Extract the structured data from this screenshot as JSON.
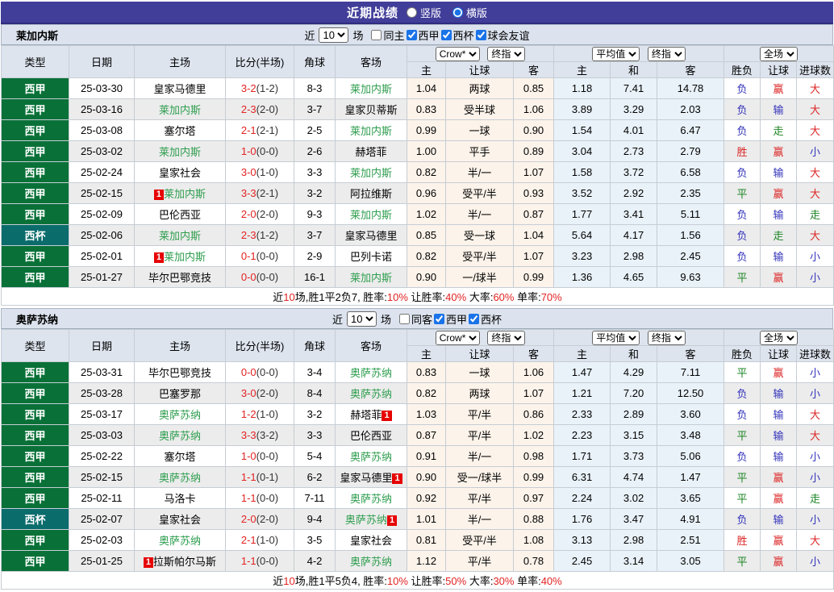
{
  "top_bar": {
    "title": "近期战绩",
    "view_options": [
      {
        "label": "竖版",
        "selected": false
      },
      {
        "label": "横版",
        "selected": true
      }
    ]
  },
  "colors": {
    "top_bar_bg": "#413e9a",
    "liga_green": "#097138",
    "cup_teal": "#0b6c6c",
    "team_green": "#2f9e4f",
    "score_red": "#e32222",
    "badge_red": "#e60000",
    "bar_bg": "#dce3ee",
    "header_bg": "#dde4ee",
    "row_alt_bg": "#ececec",
    "handicap_col_bg": "#fcf3ea",
    "europe_col_bg": "#e9f2f9",
    "result_red": "#dd2626",
    "result_blue": "#3333bb",
    "result_green": "#1d8525"
  },
  "result_colors": {
    "胜": "#dd2626",
    "平": "#1d8525",
    "负": "#3333bb",
    "赢": "#dd2626",
    "走": "#1d8525",
    "输": "#3333bb",
    "大": "#dd2626",
    "小": "#3333bb"
  },
  "sections": [
    {
      "team": "莱加内斯",
      "filter": {
        "recent_label": "近",
        "count_value": "10",
        "matches_label": "场",
        "checkboxes": [
          {
            "label": "同主",
            "checked": false
          },
          {
            "label": "西甲",
            "checked": true
          },
          {
            "label": "西杯",
            "checked": true
          },
          {
            "label": "球会友谊",
            "checked": true
          }
        ]
      },
      "header": {
        "cols": [
          "类型",
          "日期",
          "主场",
          "比分(半场)",
          "角球",
          "客场"
        ],
        "group1_selects": [
          "Crow*",
          "终指"
        ],
        "group2_selects": [
          "平均值",
          "终指"
        ],
        "group3_selects": [
          "全场"
        ],
        "sub": [
          "主",
          "让球",
          "客",
          "主",
          "和",
          "客",
          "胜负",
          "让球",
          "进球数"
        ]
      },
      "rows": [
        {
          "league": {
            "text": "西甲",
            "type": "liga"
          },
          "date": "25-03-30",
          "home": {
            "name": "皇家马德里",
            "green": false,
            "badge": null
          },
          "score": {
            "ft": "3-2",
            "ht": "(1-2)"
          },
          "corner": "8-3",
          "away": {
            "name": "莱加内斯",
            "green": true,
            "badge": null
          },
          "ah": [
            "1.04",
            "两球",
            "0.85"
          ],
          "eu": [
            "1.18",
            "7.41",
            "14.78"
          ],
          "results": [
            "负",
            "赢",
            "大"
          ]
        },
        {
          "league": {
            "text": "西甲",
            "type": "liga"
          },
          "date": "25-03-16",
          "home": {
            "name": "莱加内斯",
            "green": true,
            "badge": null
          },
          "score": {
            "ft": "2-3",
            "ht": "(2-0)"
          },
          "corner": "3-7",
          "away": {
            "name": "皇家贝蒂斯",
            "green": false,
            "badge": null
          },
          "ah": [
            "0.83",
            "受半球",
            "1.06"
          ],
          "eu": [
            "3.89",
            "3.29",
            "2.03"
          ],
          "results": [
            "负",
            "输",
            "大"
          ]
        },
        {
          "league": {
            "text": "西甲",
            "type": "liga"
          },
          "date": "25-03-08",
          "home": {
            "name": "塞尔塔",
            "green": false,
            "badge": null
          },
          "score": {
            "ft": "2-1",
            "ht": "(2-1)"
          },
          "corner": "2-5",
          "away": {
            "name": "莱加内斯",
            "green": true,
            "badge": null
          },
          "ah": [
            "0.99",
            "一球",
            "0.90"
          ],
          "eu": [
            "1.54",
            "4.01",
            "6.47"
          ],
          "results": [
            "负",
            "走",
            "大"
          ]
        },
        {
          "league": {
            "text": "西甲",
            "type": "liga"
          },
          "date": "25-03-02",
          "home": {
            "name": "莱加内斯",
            "green": true,
            "badge": null
          },
          "score": {
            "ft": "1-0",
            "ht": "(0-0)"
          },
          "corner": "2-6",
          "away": {
            "name": "赫塔菲",
            "green": false,
            "badge": null
          },
          "ah": [
            "1.00",
            "平手",
            "0.89"
          ],
          "eu": [
            "3.04",
            "2.73",
            "2.79"
          ],
          "results": [
            "胜",
            "赢",
            "小"
          ]
        },
        {
          "league": {
            "text": "西甲",
            "type": "liga"
          },
          "date": "25-02-24",
          "home": {
            "name": "皇家社会",
            "green": false,
            "badge": null
          },
          "score": {
            "ft": "3-0",
            "ht": "(1-0)"
          },
          "corner": "3-3",
          "away": {
            "name": "莱加内斯",
            "green": true,
            "badge": null
          },
          "ah": [
            "0.82",
            "半/一",
            "1.07"
          ],
          "eu": [
            "1.58",
            "3.72",
            "6.58"
          ],
          "results": [
            "负",
            "输",
            "大"
          ]
        },
        {
          "league": {
            "text": "西甲",
            "type": "liga"
          },
          "date": "25-02-15",
          "home": {
            "name": "莱加内斯",
            "green": true,
            "badge": {
              "text": "1",
              "pos": "before"
            }
          },
          "score": {
            "ft": "3-3",
            "ht": "(2-1)"
          },
          "corner": "3-2",
          "away": {
            "name": "阿拉维斯",
            "green": false,
            "badge": null
          },
          "ah": [
            "0.96",
            "受平/半",
            "0.93"
          ],
          "eu": [
            "3.52",
            "2.92",
            "2.35"
          ],
          "results": [
            "平",
            "赢",
            "大"
          ]
        },
        {
          "league": {
            "text": "西甲",
            "type": "liga"
          },
          "date": "25-02-09",
          "home": {
            "name": "巴伦西亚",
            "green": false,
            "badge": null
          },
          "score": {
            "ft": "2-0",
            "ht": "(2-0)"
          },
          "corner": "9-3",
          "away": {
            "name": "莱加内斯",
            "green": true,
            "badge": null
          },
          "ah": [
            "1.02",
            "半/一",
            "0.87"
          ],
          "eu": [
            "1.77",
            "3.41",
            "5.11"
          ],
          "results": [
            "负",
            "输",
            "走"
          ]
        },
        {
          "league": {
            "text": "西杯",
            "type": "cup"
          },
          "date": "25-02-06",
          "home": {
            "name": "莱加内斯",
            "green": true,
            "badge": null
          },
          "score": {
            "ft": "2-3",
            "ht": "(1-2)"
          },
          "corner": "3-7",
          "away": {
            "name": "皇家马德里",
            "green": false,
            "badge": null
          },
          "ah": [
            "0.85",
            "受一球",
            "1.04"
          ],
          "eu": [
            "5.64",
            "4.17",
            "1.56"
          ],
          "results": [
            "负",
            "走",
            "大"
          ]
        },
        {
          "league": {
            "text": "西甲",
            "type": "liga"
          },
          "date": "25-02-01",
          "home": {
            "name": "莱加内斯",
            "green": true,
            "badge": {
              "text": "1",
              "pos": "before"
            }
          },
          "score": {
            "ft": "0-1",
            "ht": "(0-0)"
          },
          "corner": "2-9",
          "away": {
            "name": "巴列卡诺",
            "green": false,
            "badge": null
          },
          "ah": [
            "0.82",
            "受平/半",
            "1.07"
          ],
          "eu": [
            "3.23",
            "2.98",
            "2.45"
          ],
          "results": [
            "负",
            "输",
            "小"
          ]
        },
        {
          "league": {
            "text": "西甲",
            "type": "liga"
          },
          "date": "25-01-27",
          "home": {
            "name": "毕尔巴鄂竞技",
            "green": false,
            "badge": null
          },
          "score": {
            "ft": "0-0",
            "ht": "(0-0)"
          },
          "corner": "16-1",
          "away": {
            "name": "莱加内斯",
            "green": true,
            "badge": null
          },
          "ah": [
            "0.90",
            "一/球半",
            "0.99"
          ],
          "eu": [
            "1.36",
            "4.65",
            "9.63"
          ],
          "results": [
            "平",
            "赢",
            "小"
          ]
        }
      ],
      "footer": {
        "segments": [
          {
            "text": "近"
          },
          {
            "text": "10",
            "red": true
          },
          {
            "text": "场,胜1平2负7, 胜率:"
          },
          {
            "text": "10%",
            "red": true
          },
          {
            "text": " 让胜率:"
          },
          {
            "text": "40%",
            "red": true
          },
          {
            "text": " 大率:"
          },
          {
            "text": "60%",
            "red": true
          },
          {
            "text": " 单率:"
          },
          {
            "text": "70%",
            "red": true
          }
        ]
      }
    },
    {
      "team": "奥萨苏纳",
      "filter": {
        "recent_label": "近",
        "count_value": "10",
        "matches_label": "场",
        "checkboxes": [
          {
            "label": "同客",
            "checked": false
          },
          {
            "label": "西甲",
            "checked": true
          },
          {
            "label": "西杯",
            "checked": true
          }
        ]
      },
      "header": {
        "cols": [
          "类型",
          "日期",
          "主场",
          "比分(半场)",
          "角球",
          "客场"
        ],
        "group1_selects": [
          "Crow*",
          "终指"
        ],
        "group2_selects": [
          "平均值",
          "终指"
        ],
        "group3_selects": [
          "全场"
        ],
        "sub": [
          "主",
          "让球",
          "客",
          "主",
          "和",
          "客",
          "胜负",
          "让球",
          "进球数"
        ]
      },
      "rows": [
        {
          "league": {
            "text": "西甲",
            "type": "liga"
          },
          "date": "25-03-31",
          "home": {
            "name": "毕尔巴鄂竞技",
            "green": false,
            "badge": null
          },
          "score": {
            "ft": "0-0",
            "ht": "(0-0)"
          },
          "corner": "3-4",
          "away": {
            "name": "奥萨苏纳",
            "green": true,
            "badge": null
          },
          "ah": [
            "0.83",
            "一球",
            "1.06"
          ],
          "eu": [
            "1.47",
            "4.29",
            "7.11"
          ],
          "results": [
            "平",
            "赢",
            "小"
          ]
        },
        {
          "league": {
            "text": "西甲",
            "type": "liga"
          },
          "date": "25-03-28",
          "home": {
            "name": "巴塞罗那",
            "green": false,
            "badge": null
          },
          "score": {
            "ft": "3-0",
            "ht": "(2-0)"
          },
          "corner": "8-4",
          "away": {
            "name": "奥萨苏纳",
            "green": true,
            "badge": null
          },
          "ah": [
            "0.82",
            "两球",
            "1.07"
          ],
          "eu": [
            "1.21",
            "7.20",
            "12.50"
          ],
          "results": [
            "负",
            "输",
            "小"
          ]
        },
        {
          "league": {
            "text": "西甲",
            "type": "liga"
          },
          "date": "25-03-17",
          "home": {
            "name": "奥萨苏纳",
            "green": true,
            "badge": null
          },
          "score": {
            "ft": "1-2",
            "ht": "(1-0)"
          },
          "corner": "3-2",
          "away": {
            "name": "赫塔菲",
            "green": false,
            "badge": {
              "text": "1",
              "pos": "after"
            }
          },
          "ah": [
            "1.03",
            "平/半",
            "0.86"
          ],
          "eu": [
            "2.33",
            "2.89",
            "3.60"
          ],
          "results": [
            "负",
            "输",
            "大"
          ]
        },
        {
          "league": {
            "text": "西甲",
            "type": "liga"
          },
          "date": "25-03-03",
          "home": {
            "name": "奥萨苏纳",
            "green": true,
            "badge": null
          },
          "score": {
            "ft": "3-3",
            "ht": "(3-2)"
          },
          "corner": "3-3",
          "away": {
            "name": "巴伦西亚",
            "green": false,
            "badge": null
          },
          "ah": [
            "0.87",
            "平/半",
            "1.02"
          ],
          "eu": [
            "2.23",
            "3.15",
            "3.48"
          ],
          "results": [
            "平",
            "输",
            "大"
          ]
        },
        {
          "league": {
            "text": "西甲",
            "type": "liga"
          },
          "date": "25-02-22",
          "home": {
            "name": "塞尔塔",
            "green": false,
            "badge": null
          },
          "score": {
            "ft": "1-0",
            "ht": "(0-0)"
          },
          "corner": "5-4",
          "away": {
            "name": "奥萨苏纳",
            "green": true,
            "badge": null
          },
          "ah": [
            "0.91",
            "半/一",
            "0.98"
          ],
          "eu": [
            "1.71",
            "3.73",
            "5.06"
          ],
          "results": [
            "负",
            "输",
            "小"
          ]
        },
        {
          "league": {
            "text": "西甲",
            "type": "liga"
          },
          "date": "25-02-15",
          "home": {
            "name": "奥萨苏纳",
            "green": true,
            "badge": null
          },
          "score": {
            "ft": "1-1",
            "ht": "(0-1)"
          },
          "corner": "6-2",
          "away": {
            "name": "皇家马德里",
            "green": false,
            "badge": {
              "text": "1",
              "pos": "after"
            }
          },
          "ah": [
            "0.90",
            "受一/球半",
            "0.99"
          ],
          "eu": [
            "6.31",
            "4.74",
            "1.47"
          ],
          "results": [
            "平",
            "赢",
            "小"
          ]
        },
        {
          "league": {
            "text": "西甲",
            "type": "liga"
          },
          "date": "25-02-11",
          "home": {
            "name": "马洛卡",
            "green": false,
            "badge": null
          },
          "score": {
            "ft": "1-1",
            "ht": "(0-0)"
          },
          "corner": "7-11",
          "away": {
            "name": "奥萨苏纳",
            "green": true,
            "badge": null
          },
          "ah": [
            "0.92",
            "平/半",
            "0.97"
          ],
          "eu": [
            "2.24",
            "3.02",
            "3.65"
          ],
          "results": [
            "平",
            "赢",
            "走"
          ]
        },
        {
          "league": {
            "text": "西杯",
            "type": "cup"
          },
          "date": "25-02-07",
          "home": {
            "name": "皇家社会",
            "green": false,
            "badge": null
          },
          "score": {
            "ft": "2-0",
            "ht": "(2-0)"
          },
          "corner": "9-4",
          "away": {
            "name": "奥萨苏纳",
            "green": true,
            "badge": {
              "text": "1",
              "pos": "after"
            }
          },
          "ah": [
            "1.01",
            "半/一",
            "0.88"
          ],
          "eu": [
            "1.76",
            "3.47",
            "4.91"
          ],
          "results": [
            "负",
            "输",
            "小"
          ]
        },
        {
          "league": {
            "text": "西甲",
            "type": "liga"
          },
          "date": "25-02-03",
          "home": {
            "name": "奥萨苏纳",
            "green": true,
            "badge": null
          },
          "score": {
            "ft": "2-1",
            "ht": "(1-0)"
          },
          "corner": "3-5",
          "away": {
            "name": "皇家社会",
            "green": false,
            "badge": null
          },
          "ah": [
            "0.81",
            "受平/半",
            "1.08"
          ],
          "eu": [
            "3.13",
            "2.98",
            "2.51"
          ],
          "results": [
            "胜",
            "赢",
            "大"
          ]
        },
        {
          "league": {
            "text": "西甲",
            "type": "liga"
          },
          "date": "25-01-25",
          "home": {
            "name": "拉斯帕尔马斯",
            "green": false,
            "badge": {
              "text": "1",
              "pos": "before"
            }
          },
          "score": {
            "ft": "1-1",
            "ht": "(0-0)"
          },
          "corner": "4-2",
          "away": {
            "name": "奥萨苏纳",
            "green": true,
            "badge": null
          },
          "ah": [
            "1.12",
            "平/半",
            "0.78"
          ],
          "eu": [
            "2.45",
            "3.14",
            "3.05"
          ],
          "results": [
            "平",
            "赢",
            "小"
          ]
        }
      ],
      "footer": {
        "segments": [
          {
            "text": "近"
          },
          {
            "text": "10",
            "red": true
          },
          {
            "text": "场,胜1平5负4, 胜率:"
          },
          {
            "text": "10%",
            "red": true
          },
          {
            "text": " 让胜率:"
          },
          {
            "text": "50%",
            "red": true
          },
          {
            "text": " 大率:"
          },
          {
            "text": "30%",
            "red": true
          },
          {
            "text": " 单率:"
          },
          {
            "text": "40%",
            "red": true
          }
        ]
      }
    }
  ]
}
